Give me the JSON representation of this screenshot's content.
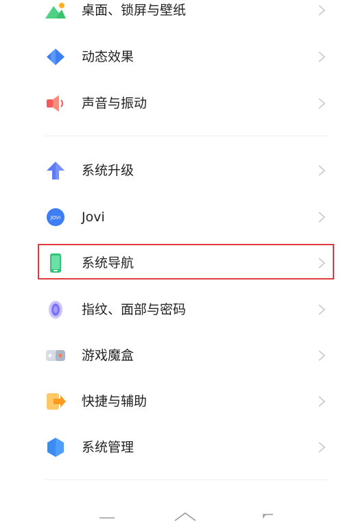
{
  "settings": {
    "items": [
      {
        "label": "桌面、锁屏与壁纸",
        "icon": "wallpaper-icon"
      },
      {
        "label": "动态效果",
        "icon": "dynamic-effects-icon"
      },
      {
        "label": "声音与振动",
        "icon": "sound-icon"
      },
      {
        "label": "系统升级",
        "icon": "system-update-icon"
      },
      {
        "label": "Jovi",
        "icon": "jovi-icon"
      },
      {
        "label": "系统导航",
        "icon": "system-navigation-icon",
        "highlighted": true
      },
      {
        "label": "指纹、面部与密码",
        "icon": "fingerprint-icon"
      },
      {
        "label": "游戏魔盒",
        "icon": "game-box-icon"
      },
      {
        "label": "快捷与辅助",
        "icon": "shortcuts-icon"
      },
      {
        "label": "系统管理",
        "icon": "system-management-icon"
      }
    ],
    "jovi_icon_text": "JOVI"
  },
  "highlight_color": "#e0393c",
  "navigation_bar": {
    "buttons": [
      "menu-icon",
      "home-icon",
      "back-icon"
    ]
  }
}
